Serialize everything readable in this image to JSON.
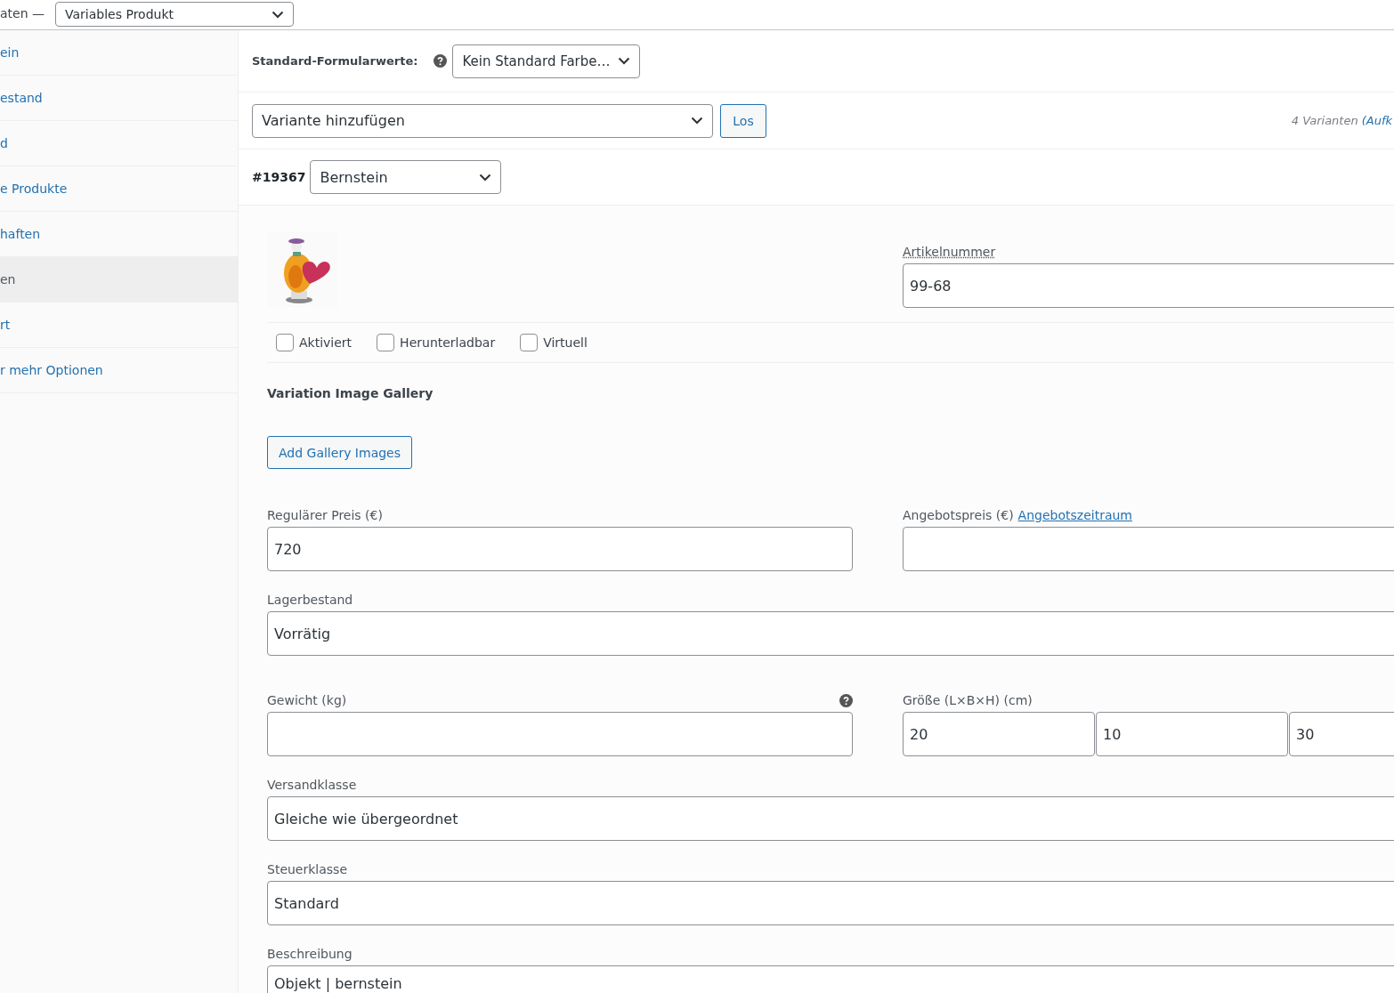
{
  "header": {
    "label": "aten —",
    "product_type": "Variables Produkt"
  },
  "sidebar": {
    "items": [
      {
        "label": "ein",
        "selected": false
      },
      {
        "label": "estand",
        "selected": false
      },
      {
        "label": "d",
        "selected": false
      },
      {
        "label": "e Produkte",
        "selected": false
      },
      {
        "label": "haften",
        "selected": false
      },
      {
        "label": "en",
        "selected": true
      },
      {
        "label": "rt",
        "selected": false
      },
      {
        "label": "r mehr Optionen",
        "selected": false
      }
    ]
  },
  "defaults": {
    "label": "Standard-Formularwerte:",
    "value": "Kein Standard Farbe…"
  },
  "bulk": {
    "action": "Variante hinzufügen",
    "button": "Los",
    "count": "4 Varianten",
    "link": "(Aufk"
  },
  "variation": {
    "id": "#19367",
    "attribute": "Bernstein",
    "sku": {
      "label": "Artikelnummer",
      "value": "99-68"
    },
    "options": [
      {
        "label": "Aktiviert",
        "checked": false
      },
      {
        "label": "Herunterladbar",
        "checked": false
      },
      {
        "label": "Virtuell",
        "checked": false
      }
    ],
    "gallery": {
      "title": "Variation Image Gallery",
      "button": "Add Gallery Images"
    },
    "regular_price": {
      "label": "Regulärer Preis (€)",
      "value": "720"
    },
    "sale_price": {
      "label": "Angebotspreis (€)",
      "link": "Angebotszeitraum"
    },
    "stock": {
      "label": "Lagerbestand",
      "value": "Vorrätig"
    },
    "weight": {
      "label": "Gewicht (kg)"
    },
    "dimensions": {
      "label": "Größe (L×B×H) (cm)",
      "values": [
        "20",
        "10",
        "30"
      ]
    },
    "shipping_class": {
      "label": "Versandklasse",
      "value": "Gleiche wie übergeordnet"
    },
    "tax_class": {
      "label": "Steuerklasse",
      "value": "Standard"
    },
    "description": {
      "label": "Beschreibung",
      "value": "Objekt | bernstein"
    }
  }
}
